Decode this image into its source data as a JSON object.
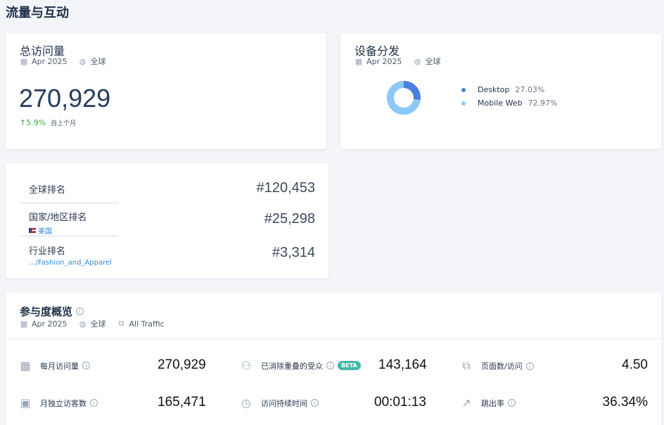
{
  "page_title": "流量与互动",
  "colors": {
    "desktop": "#4a7fe0",
    "mobile": "#8cc8f8",
    "up": "#3aa845",
    "link": "#2f8ad6",
    "beta": "#3fb9a8"
  },
  "total_visits": {
    "title": "总访问量",
    "date": "Apr 2025",
    "region": "全球",
    "value": "270,929",
    "change": "↑5.9%",
    "change_label": "自上个月"
  },
  "device": {
    "title": "设备分发",
    "date": "Apr 2025",
    "region": "全球",
    "items": [
      {
        "label": "Desktop",
        "pct": "27.03%",
        "value": 27.03
      },
      {
        "label": "Mobile Web",
        "pct": "72.97%",
        "value": 72.97
      }
    ]
  },
  "ranks": {
    "global_label": "全球排名",
    "global_value": "#120,453",
    "country_label": "国家/地区排名",
    "country_sub": "美国",
    "country_value": "#25,298",
    "industry_label": "行业排名",
    "industry_sub": ".../Fashion_and_Apparel",
    "industry_value": "#3,314"
  },
  "engagement": {
    "title": "参与度概览",
    "date": "Apr 2025",
    "region": "全球",
    "traffic": "All Traffic",
    "beta": "BETA",
    "metrics": {
      "monthly_visits_label": "每月访问量",
      "monthly_visits_value": "270,929",
      "dedup_label": "已消除重叠的受众",
      "dedup_value": "143,164",
      "pages_label": "页面数/访问",
      "pages_value": "4.50",
      "unique_label": "月独立访客数",
      "unique_value": "165,471",
      "duration_label": "访问持续时间",
      "duration_value": "00:01:13",
      "bounce_label": "跳出率",
      "bounce_value": "36.34%"
    }
  }
}
